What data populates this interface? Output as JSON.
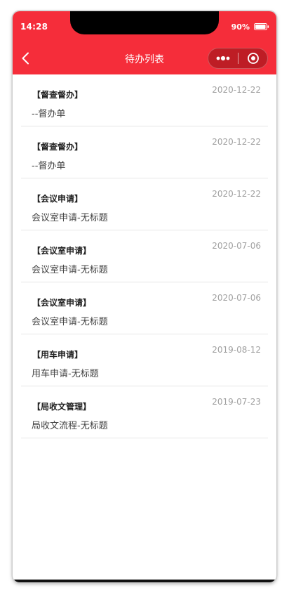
{
  "status_bar": {
    "time": "14:28",
    "battery_percent": "90%"
  },
  "nav": {
    "title": "待办列表"
  },
  "icons": {
    "back": "chevron-left-icon",
    "menu": "more-dots-icon",
    "close": "target-close-icon"
  },
  "colors": {
    "brand_red": "#f52d3a",
    "date_gray": "#a0a0a0"
  },
  "items": [
    {
      "title": "【督查督办】",
      "date": "2020-12-22",
      "desc": "--督办单"
    },
    {
      "title": "【督查督办】",
      "date": "2020-12-22",
      "desc": "--督办单"
    },
    {
      "title": "【会议申请】",
      "date": "2020-12-22",
      "desc": "会议室申请-无标题"
    },
    {
      "title": "【会议室申请】",
      "date": "2020-07-06",
      "desc": "会议室申请-无标题"
    },
    {
      "title": "【会议室申请】",
      "date": "2020-07-06",
      "desc": "会议室申请-无标题"
    },
    {
      "title": "【用车申请】",
      "date": "2019-08-12",
      "desc": "用车申请-无标题"
    },
    {
      "title": "【局收文管理】",
      "date": "2019-07-23",
      "desc": "局收文流程-无标题"
    }
  ]
}
